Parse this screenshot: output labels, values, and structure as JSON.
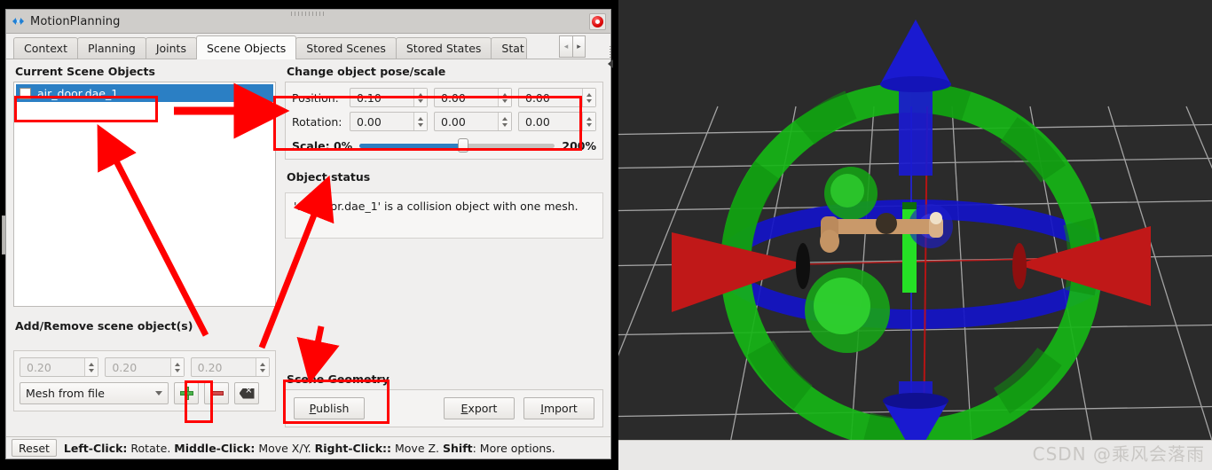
{
  "window": {
    "title": "MotionPlanning",
    "icon": "rviz-icon",
    "close_icon": "close-icon"
  },
  "tabs": [
    {
      "label": "Context",
      "active": false
    },
    {
      "label": "Planning",
      "active": false
    },
    {
      "label": "Joints",
      "active": false
    },
    {
      "label": "Scene Objects",
      "active": true
    },
    {
      "label": "Stored Scenes",
      "active": false
    },
    {
      "label": "Stored States",
      "active": false
    },
    {
      "label": "Stat",
      "active": false,
      "clipped": true
    }
  ],
  "tab_scroll": {
    "left": "◂",
    "right": "▸"
  },
  "scene_objects": {
    "group_label": "Current Scene Objects",
    "items": [
      {
        "name": "air_door.dae_1",
        "checked": false,
        "selected": true
      }
    ]
  },
  "add_remove": {
    "group_label": "Add/Remove scene object(s)",
    "dims": [
      "0.20",
      "0.20",
      "0.20"
    ],
    "dims_enabled": false,
    "shape_select": "Mesh from file",
    "add_icon": "plus-icon",
    "remove_icon": "minus-icon",
    "clear_icon": "backspace-icon"
  },
  "pose": {
    "group_label": "Change object pose/scale",
    "position_label": "Position:",
    "position": [
      "0.10",
      "0.00",
      "0.00"
    ],
    "rotation_label": "Rotation:",
    "rotation": [
      "0.00",
      "0.00",
      "0.00"
    ],
    "scale_label": "Scale: 0%",
    "scale_max_label": "200%",
    "scale_percent": 53
  },
  "object_status": {
    "group_label": "Object status",
    "text": "'air_door.dae_1' is a collision object with one mesh."
  },
  "scene_geometry": {
    "group_label": "Scene Geometry",
    "publish": {
      "label": "Publish",
      "accel": "P"
    },
    "export": {
      "label": "Export",
      "accel": "E"
    },
    "import": {
      "label": "Import",
      "accel": "I"
    }
  },
  "statusbar": {
    "reset_label": "Reset",
    "hints": [
      {
        "key": "Left-Click:",
        "action": " Rotate. "
      },
      {
        "key": "Middle-Click:",
        "action": " Move X/Y. "
      },
      {
        "key": "Right-Click::",
        "action": " Move Z. "
      },
      {
        "key": "Shift",
        "action": ": More options."
      }
    ]
  },
  "viewport": {
    "watermark": "CSDN @乘风会落雨",
    "background": "#2b2b2b",
    "grid_color": "#b9b9b9",
    "marker_colors": {
      "ring": "#16b516",
      "arrow_x": "#c02020",
      "arrow_z": "#1818c8",
      "band": "#1414c0",
      "mesh": "#c49464"
    }
  },
  "annotations": {
    "color": "#ff0000",
    "boxes": [
      "scene-object-item",
      "pose-fields",
      "add-button",
      "publish-button"
    ],
    "arrows": [
      "to-scene-object-item",
      "to-add-button",
      "to-publish-button"
    ]
  }
}
